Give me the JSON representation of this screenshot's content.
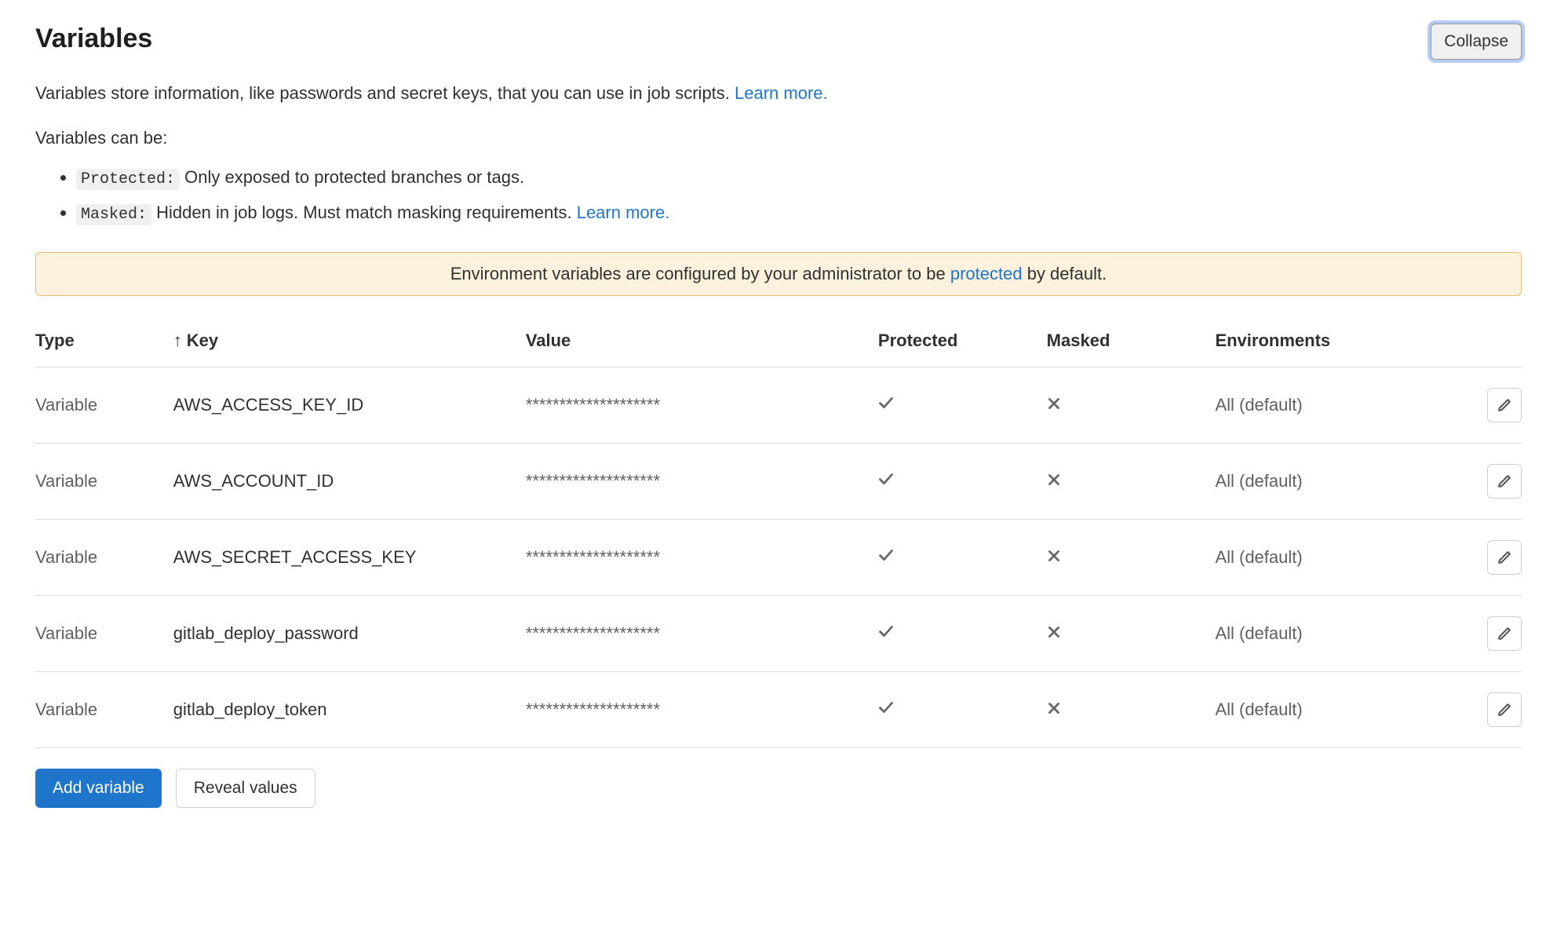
{
  "header": {
    "title": "Variables",
    "collapse_label": "Collapse"
  },
  "description": {
    "text": "Variables store information, like passwords and secret keys, that you can use in job scripts. ",
    "learn_more": "Learn more."
  },
  "subheading": "Variables can be:",
  "features": {
    "protected": {
      "badge": "Protected:",
      "text": " Only exposed to protected branches or tags."
    },
    "masked": {
      "badge": "Masked:",
      "text": " Hidden in job logs. Must match masking requirements. ",
      "learn_more": "Learn more."
    }
  },
  "banner": {
    "prefix": "Environment variables are configured by your administrator to be ",
    "link": "protected",
    "suffix": " by default."
  },
  "table": {
    "headers": {
      "type": "Type",
      "key": "Key",
      "value": "Value",
      "protected": "Protected",
      "masked": "Masked",
      "environments": "Environments"
    },
    "sort_indicator": "↑",
    "rows": [
      {
        "type": "Variable",
        "key": "AWS_ACCESS_KEY_ID",
        "value": "********************",
        "protected": true,
        "masked": false,
        "environments": "All (default)"
      },
      {
        "type": "Variable",
        "key": "AWS_ACCOUNT_ID",
        "value": "********************",
        "protected": true,
        "masked": false,
        "environments": "All (default)"
      },
      {
        "type": "Variable",
        "key": "AWS_SECRET_ACCESS_KEY",
        "value": "********************",
        "protected": true,
        "masked": false,
        "environments": "All (default)"
      },
      {
        "type": "Variable",
        "key": "gitlab_deploy_password",
        "value": "********************",
        "protected": true,
        "masked": false,
        "environments": "All (default)"
      },
      {
        "type": "Variable",
        "key": "gitlab_deploy_token",
        "value": "********************",
        "protected": true,
        "masked": false,
        "environments": "All (default)"
      }
    ]
  },
  "actions": {
    "add_variable": "Add variable",
    "reveal_values": "Reveal values"
  }
}
